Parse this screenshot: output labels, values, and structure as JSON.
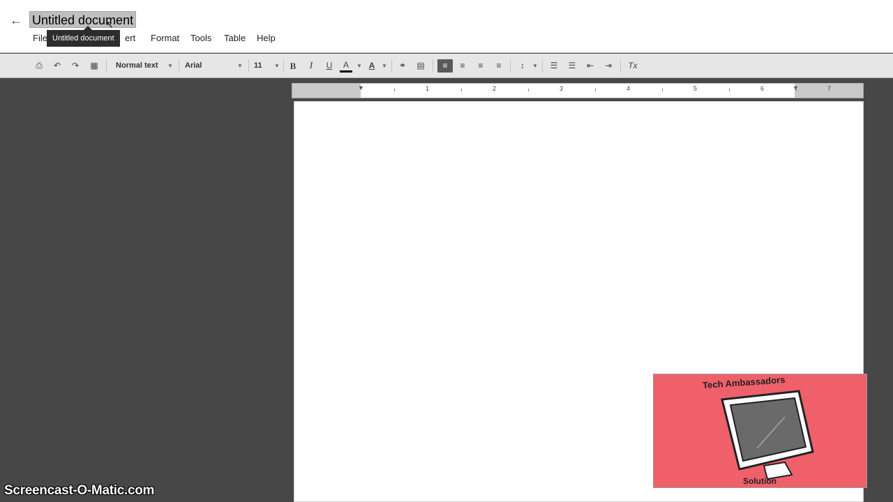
{
  "header": {
    "back_icon": "arrow-left-icon",
    "title": "Untitled document",
    "tooltip": "Untitled document",
    "menu": [
      "File",
      "ert",
      "Format",
      "Tools",
      "Table",
      "Help"
    ]
  },
  "toolbar": {
    "style_value": "Normal text",
    "font_value": "Arial",
    "size_value": "11",
    "bold": "B",
    "italic": "I",
    "underline": "U",
    "text_color": "A",
    "highlight": "A",
    "clear_format": "Tx",
    "active_alignment": "left"
  },
  "ruler": {
    "numbers": [
      "1",
      "2",
      "3",
      "4",
      "5",
      "6",
      "7"
    ]
  },
  "overlay": {
    "watermark": "Screencast-O-Matic.com",
    "logo_top_text": "Tech Ambassadors",
    "logo_bottom_text": "Solution",
    "logo_color": "#f0606b"
  }
}
